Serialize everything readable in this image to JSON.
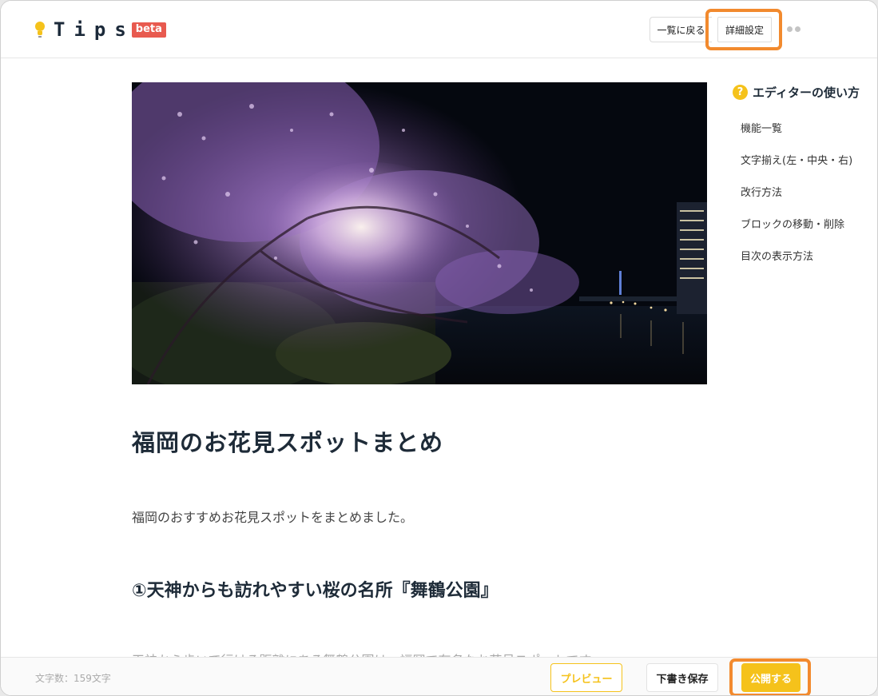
{
  "header": {
    "logo_text": "Tips",
    "beta_label": "beta",
    "back_label": "一覧に戻る",
    "detail_label": "詳細設定"
  },
  "article": {
    "title": "福岡のお花見スポットまとめ",
    "lead": "福岡のおすすめお花見スポットをまとめました。",
    "heading1": "①天神からも訪れやすい桜の名所『舞鶴公園』",
    "partial": "天神から歩いて行ける距離にある舞鶴公園は、福岡で有名なお花見スポットです。"
  },
  "help": {
    "title": "エディターの使い方",
    "q_mark": "?",
    "items": [
      {
        "label": "機能一覧"
      },
      {
        "label": "文字揃え(左・中央・右)"
      },
      {
        "label": "改行方法"
      },
      {
        "label": "ブロックの移動・削除"
      },
      {
        "label": "目次の表示方法"
      }
    ]
  },
  "footer": {
    "wordcount": "文字数：159文字",
    "preview_label": "プレビュー",
    "draft_label": "下書き保存",
    "publish_label": "公開する"
  },
  "colors": {
    "accent_yellow": "#f5c21b",
    "highlight_orange": "#f28a2e",
    "beta_red": "#e85a4f",
    "title_navy": "#1e2b38"
  },
  "icons": {
    "logo": "lightbulb-icon",
    "help": "question-mark-icon",
    "more": "more-dots-icon"
  }
}
